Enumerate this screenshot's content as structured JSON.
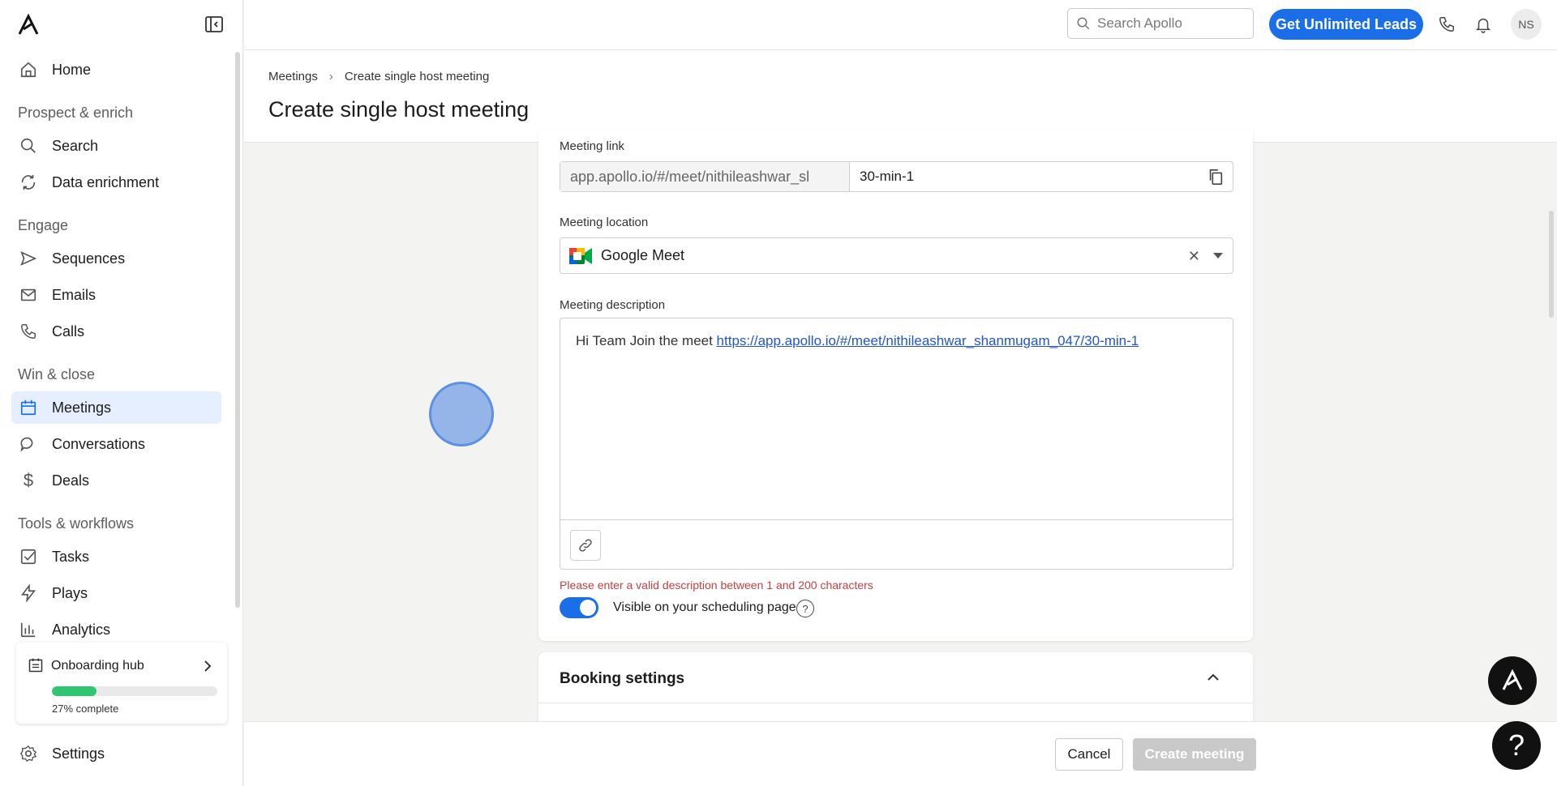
{
  "topbar": {
    "search_placeholder": "Search Apollo",
    "cta_label": "Get Unlimited Leads",
    "avatar_initials": "NS"
  },
  "sidebar": {
    "home": "Home",
    "section_prospect": "Prospect & enrich",
    "search": "Search",
    "data_enrichment": "Data enrichment",
    "section_engage": "Engage",
    "sequences": "Sequences",
    "emails": "Emails",
    "calls": "Calls",
    "section_win": "Win & close",
    "meetings": "Meetings",
    "conversations": "Conversations",
    "deals": "Deals",
    "section_tools": "Tools & workflows",
    "tasks": "Tasks",
    "plays": "Plays",
    "analytics": "Analytics",
    "settings": "Settings",
    "onboarding": {
      "title": "Onboarding hub",
      "progress_label": "27% complete",
      "progress": 0.27
    }
  },
  "header": {
    "breadcrumb_root": "Meetings",
    "breadcrumb_current": "Create single host meeting",
    "title": "Create single host meeting"
  },
  "form": {
    "link_label": "Meeting link",
    "link_prefix": "app.apollo.io/#/meet/nithileashwar_sl",
    "link_slug": "30-min-1",
    "location_label": "Meeting location",
    "location_value": "Google Meet",
    "description_label": "Meeting description",
    "description_text": "Hi Team Join the meet ",
    "description_link": "https://app.apollo.io/#/meet/nithileashwar_shanmugam_047/30-min-1",
    "error_text": "Please enter a valid description between 1 and 200 characters",
    "visible_label": "Visible on your scheduling page",
    "visible_on": true
  },
  "booking": {
    "title": "Booking settings"
  },
  "footer": {
    "cancel_label": "Cancel",
    "create_label": "Create meeting"
  },
  "colors": {
    "accent": "#1a6fe8",
    "active_nav_bg": "#e6efff",
    "error": "#c44141",
    "progress": "#30c571"
  }
}
